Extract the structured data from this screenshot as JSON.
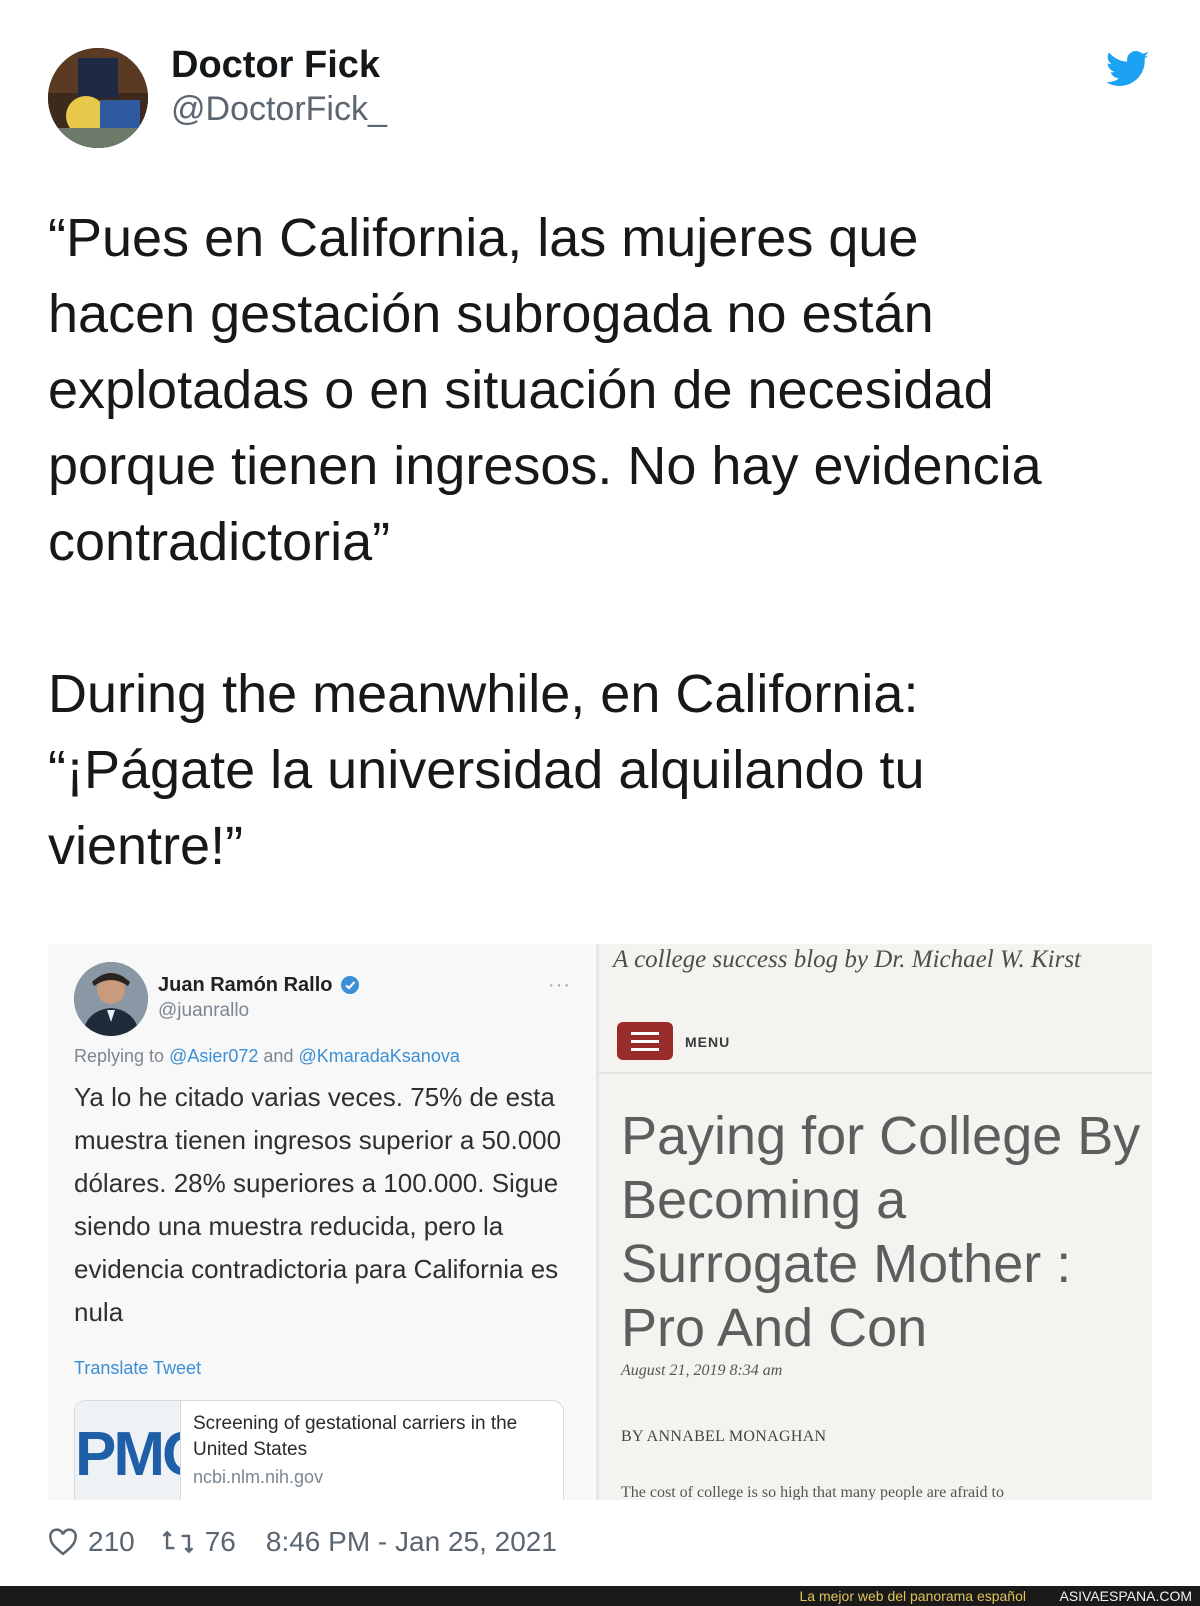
{
  "tweet": {
    "display_name": "Doctor Fick",
    "handle": "@DoctorFick_",
    "text": "“Pues en California, las mujeres que\nhacen gestación subrogada no están\nexplotadas o en situación de necesidad\nporque tienen ingresos. No hay evidencia\ncontradictoria”\n\nDuring the meanwhile, en California:\n“¡Págate la universidad alquilando tu\nvientre!”",
    "likes": "210",
    "retweets": "76",
    "timestamp": "8:46 PM - Jan 25, 2021",
    "icons": {
      "brand": "twitter-bird-icon",
      "like": "heart-icon",
      "retweet": "retweet-icon"
    },
    "colors": {
      "brand": "#1da1f2",
      "meta": "#5b6670"
    }
  },
  "embedded_tweet": {
    "display_name": "Juan Ramón Rallo",
    "handle": "@juanrallo",
    "more_label": "···",
    "reply_prefix": "Replying to",
    "reply_to_1": "@Asier072",
    "reply_and": "and",
    "reply_to_2": "@KmaradaKsanova",
    "body": "Ya lo he citado varias veces. 75% de esta muestra tienen ingresos superior a 50.000 dólares. 28% superiores a 100.000. Sigue siendo una muestra reducida, pero la evidencia contradictoria para California es nula",
    "translate_label": "Translate Tweet",
    "card": {
      "thumb_text": "PMC",
      "title": "Screening of gestational carriers in the United States",
      "domain": "ncbi.nlm.nih.gov"
    }
  },
  "blog": {
    "tagline": "A college success blog by Dr. Michael W. Kirst",
    "menu_label": "MENU",
    "title": "Paying for College By Becoming a Surrogate Mother : Pro And Con",
    "date": "August 21, 2019 8:34 am",
    "byline": "BY ANNABEL MONAGHAN",
    "excerpt": "The cost of college is so high that many people are afraid to",
    "colors": {
      "menu_button": "#9a2b2b"
    }
  },
  "site_banner": {
    "tagline": "La mejor web del panorama español",
    "site": "ASIVAESPANA.COM"
  }
}
